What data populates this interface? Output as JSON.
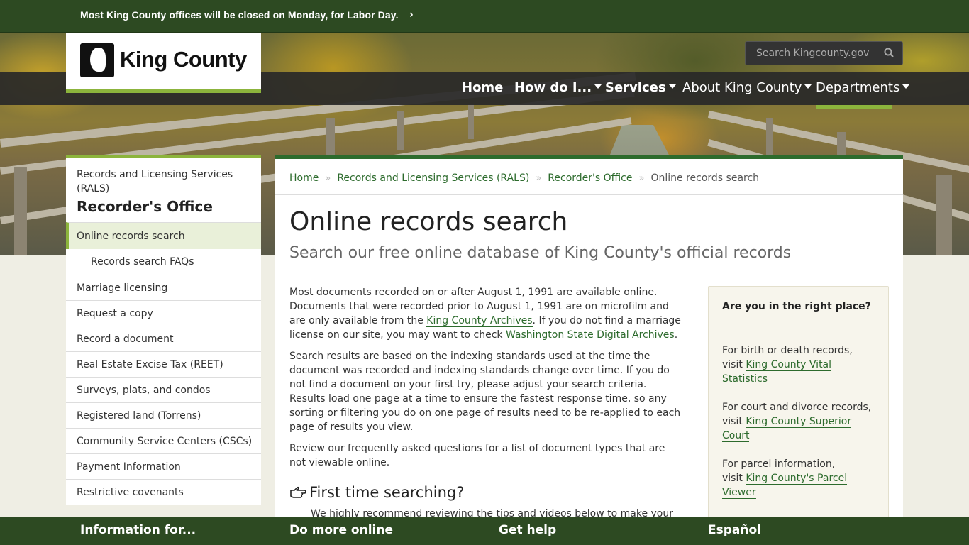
{
  "alert": {
    "message": "Most King County offices will be closed on Monday, for Labor Day."
  },
  "logo": {
    "text": "King County"
  },
  "search": {
    "placeholder": "Search Kingcounty.gov"
  },
  "nav": {
    "items": [
      {
        "label": "Home"
      },
      {
        "label": "How do I..."
      },
      {
        "label": "Services"
      },
      {
        "label": "About King County"
      },
      {
        "label": "Departments"
      }
    ]
  },
  "sidebar": {
    "parent": "Records and Licensing Services (RALS)",
    "title": "Recorder's Office",
    "items": [
      {
        "label": "Online records search"
      },
      {
        "label": "Records search FAQs"
      },
      {
        "label": "Marriage licensing"
      },
      {
        "label": "Request a copy"
      },
      {
        "label": "Record a document"
      },
      {
        "label": "Real Estate Excise Tax (REET)"
      },
      {
        "label": "Surveys, plats, and condos"
      },
      {
        "label": "Registered land (Torrens)"
      },
      {
        "label": "Community Service Centers (CSCs)"
      },
      {
        "label": "Payment Information"
      },
      {
        "label": "Restrictive covenants"
      }
    ]
  },
  "breadcrumb": {
    "items": [
      {
        "label": "Home"
      },
      {
        "label": "Records and Licensing Services (RALS)"
      },
      {
        "label": "Recorder's Office"
      }
    ],
    "current": "Online records search"
  },
  "page": {
    "title": "Online records search",
    "subtitle": "Search our free online database of King County's official records"
  },
  "content": {
    "p1_a": "Most documents recorded on or after August 1, 1991 are available online. Documents that were recorded prior to August 1, 1991 are on microfilm and are only available from the ",
    "p1_link1": "King County Archives",
    "p1_b": ". If you do not find a marriage license on our site, you may want to check ",
    "p1_link2": "Washington State Digital Archives",
    "p1_c": ".",
    "p2": "Search results are based on the indexing standards used at the time the document was recorded and indexing standards change over time. If you do not find a document on your first try, please adjust your search criteria. Results load one page at a time to ensure the fastest response time, so any sorting or filtering you do on one page of results need to be re-applied to each page of results you view.",
    "p3": "Review our frequently asked questions for a list of document types that are not viewable online.",
    "first_time_heading": "First time searching?",
    "first_time_text": "We highly recommend reviewing the tips and videos below to make your"
  },
  "aside": {
    "title": "Are you in the right place?",
    "items": [
      {
        "text_a": "For birth or death records,",
        "text_b": "visit ",
        "link": "King County Vital Statistics"
      },
      {
        "text_a": "For court and divorce records,",
        "text_b": "visit ",
        "link": "King County Superior Court"
      },
      {
        "text_a": "For parcel information,",
        "text_b": "visit ",
        "link": "King County's Parcel Viewer"
      }
    ]
  },
  "footer": {
    "items": [
      {
        "label": "Information for..."
      },
      {
        "label": "Do more online"
      },
      {
        "label": "Get help"
      },
      {
        "label": "Español"
      }
    ]
  },
  "colors": {
    "brand_green": "#2d4a22",
    "accent_green": "#8cb43c",
    "link_green": "#2d6b2d"
  }
}
